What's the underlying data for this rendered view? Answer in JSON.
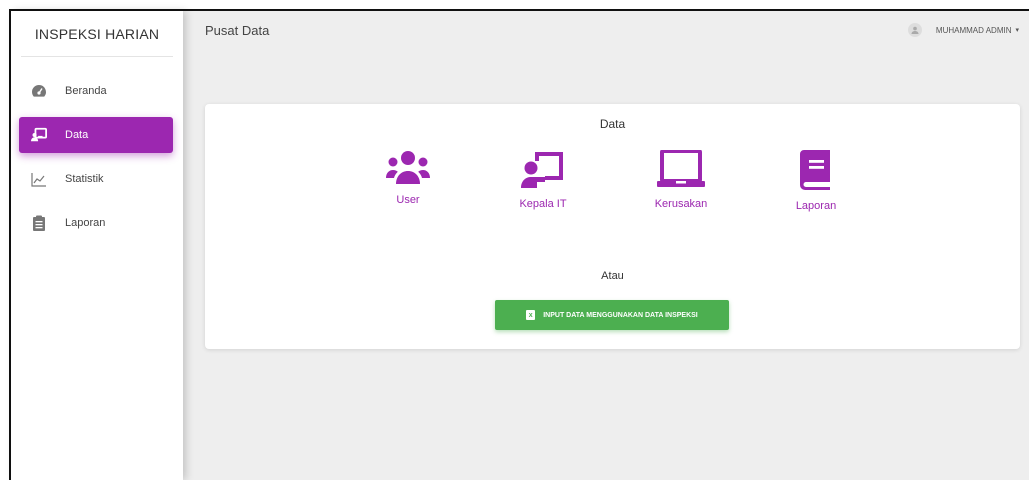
{
  "brand": {
    "title": "INSPEKSI HARIAN"
  },
  "sidebar": {
    "items": [
      {
        "label": "Beranda",
        "icon": "dashboard-icon",
        "active": false
      },
      {
        "label": "Data",
        "icon": "presentation-icon",
        "active": true
      },
      {
        "label": "Statistik",
        "icon": "trend-chart-icon",
        "active": false
      },
      {
        "label": "Laporan",
        "icon": "clipboard-icon",
        "active": false
      }
    ]
  },
  "header": {
    "title": "Pusat Data",
    "user_name": "MUHAMMAD ADMIN",
    "caret": "▾"
  },
  "card": {
    "title": "Data",
    "tiles": [
      {
        "label": "User",
        "icon": "users-icon"
      },
      {
        "label": "Kepala IT",
        "icon": "chalkboard-teacher-icon"
      },
      {
        "label": "Kerusakan",
        "icon": "laptop-icon"
      },
      {
        "label": "Laporan",
        "icon": "book-icon"
      }
    ],
    "separator": "Atau",
    "input_button_label": "INPUT DATA MENGGUNAKAN DATA INSPEKSI",
    "input_button_icon_letter": "x"
  },
  "colors": {
    "accent": "#9c27b0",
    "success": "#4caf50",
    "background": "#eeeeee"
  }
}
